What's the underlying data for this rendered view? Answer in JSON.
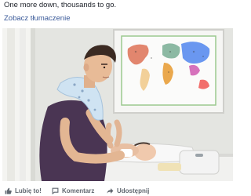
{
  "post": {
    "caption": "One more down, thousands to go.",
    "translate_link": "Zobacz tłumaczenie"
  },
  "photo": {
    "description_icon": "photo"
  },
  "actions": {
    "like_label": "Lubię to!",
    "comment_label": "Komentarz",
    "share_label": "Udostępnij"
  },
  "colors": {
    "link": "#385898",
    "text": "#1d2129",
    "muted": "#606770"
  }
}
